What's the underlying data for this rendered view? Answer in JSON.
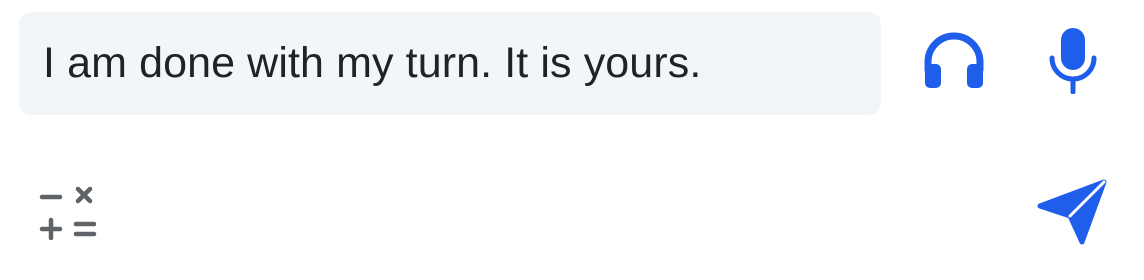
{
  "composer": {
    "text": "I am done with my turn. It is yours."
  },
  "icons": {
    "headphones": "headphones-icon",
    "microphone": "microphone-icon",
    "calculator": "math-operators-icon",
    "send": "send-icon"
  },
  "colors": {
    "accent": "#1f5eea",
    "muted_icon": "#5f6368",
    "input_bg": "#f3f6f9",
    "text": "#1f2329"
  }
}
